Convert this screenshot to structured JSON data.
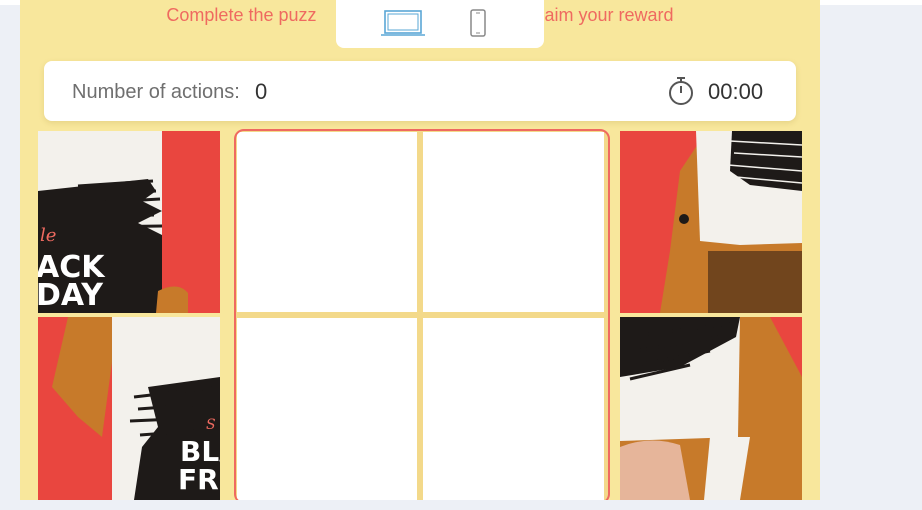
{
  "page": {
    "headline_left": "Complete the puzz",
    "headline_right": "claim your reward"
  },
  "device_switcher": {
    "desktop_icon": "laptop-icon",
    "mobile_icon": "smartphone-icon",
    "active": "desktop",
    "active_color": "#5aa7d6",
    "inactive_color": "#888888"
  },
  "stats": {
    "actions_label": "Number of actions:",
    "actions_count": "0",
    "timer_icon": "stopwatch-icon",
    "timer_value": "00:00"
  },
  "puzzle": {
    "grid": "2x2",
    "board_slots_filled": 0,
    "pieces": [
      {
        "id": "piece-1",
        "side": "left",
        "text_lines": [
          "le",
          "ACK",
          "DAY"
        ]
      },
      {
        "id": "piece-2",
        "side": "left",
        "text_lines": [
          "S",
          "BLA",
          "FRI"
        ]
      },
      {
        "id": "piece-3",
        "side": "right",
        "text_lines": []
      },
      {
        "id": "piece-4",
        "side": "right",
        "text_lines": []
      }
    ]
  },
  "colors": {
    "stage_bg": "#f8e79c",
    "accent": "#ef6a60",
    "poster_red": "#e9463f",
    "jacket": "#c77a2a"
  }
}
